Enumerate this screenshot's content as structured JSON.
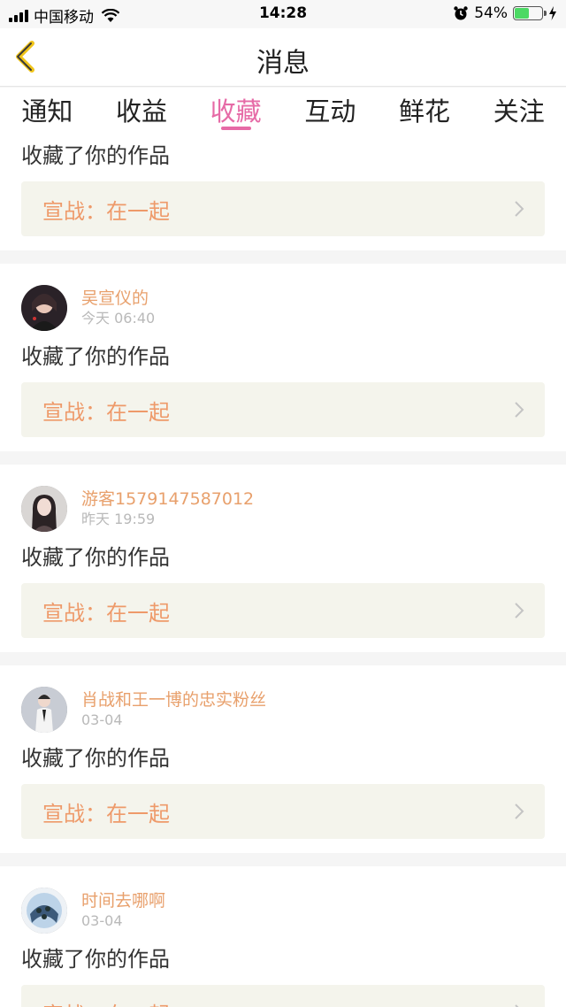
{
  "status_bar": {
    "carrier": "中国移动",
    "time": "14:28",
    "battery": "54%",
    "battery_level": 0.54
  },
  "navbar": {
    "title": "消息",
    "back_icon": "chevron-left-icon"
  },
  "tabs": [
    {
      "label": "通知",
      "active": false
    },
    {
      "label": "收益",
      "active": false
    },
    {
      "label": "收藏",
      "active": true
    },
    {
      "label": "互动",
      "active": false
    },
    {
      "label": "鲜花",
      "active": false
    },
    {
      "label": "关注",
      "active": false
    }
  ],
  "feed": {
    "first_partial": {
      "action": "收藏了你的作品",
      "work": "宣战：在一起"
    },
    "items": [
      {
        "name": "吴宣仪的",
        "time": "今天 06:40",
        "action": "收藏了你的作品",
        "work": "宣战：在一起"
      },
      {
        "name": "游客1579147587012",
        "time": "昨天 19:59",
        "action": "收藏了你的作品",
        "work": "宣战：在一起"
      },
      {
        "name": "肖战和王一博的忠实粉丝",
        "time": "03-04",
        "action": "收藏了你的作品",
        "work": "宣战：在一起"
      },
      {
        "name": "时间去哪啊",
        "time": "03-04",
        "action": "收藏了你的作品",
        "work": "宣战：在一起"
      }
    ]
  },
  "colors": {
    "accent_pink": "#e66aa6",
    "name_orange": "#e8a06c",
    "work_orange": "#ee9a6a",
    "work_box_bg": "#f4f4ec",
    "back_yellow": "#f0c419"
  }
}
